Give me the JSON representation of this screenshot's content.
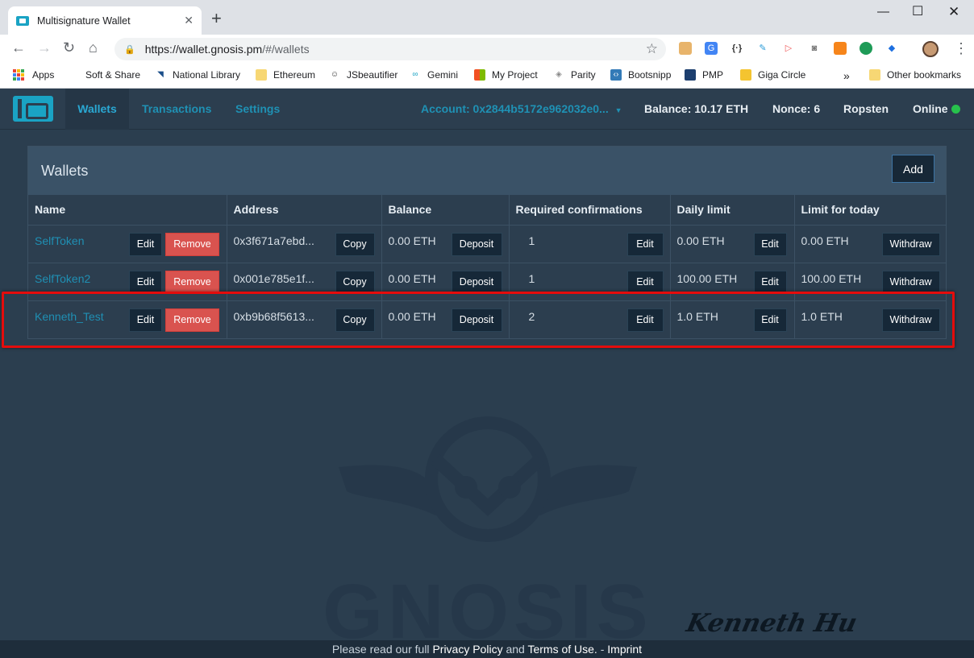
{
  "browser": {
    "tab_title": "Multisignature Wallet",
    "url_host": "https://wallet.gnosis.pm",
    "url_path": "/#/wallets",
    "bookmarks": [
      "Apps",
      "Soft & Share",
      "National Library",
      "Ethereum",
      "JSbeautifier",
      "Gemini",
      "My Project",
      "Parity",
      "Bootsnipp",
      "PMP",
      "Giga Circle",
      "Other bookmarks"
    ],
    "overflow": "»"
  },
  "nav": {
    "wallets": "Wallets",
    "transactions": "Transactions",
    "settings": "Settings",
    "account": "Account: 0x2844b5172e962032e0...",
    "balance": "Balance: 10.17 ETH",
    "nonce": "Nonce: 6",
    "network": "Ropsten",
    "status": "Online"
  },
  "panel": {
    "title": "Wallets",
    "add_label": "Add",
    "headers": [
      "Name",
      "Address",
      "Balance",
      "Required confirmations",
      "Daily limit",
      "Limit for today"
    ],
    "rows": [
      {
        "name": "SelfToken",
        "address": "0x3f671a7ebd...",
        "balance": "0.00 ETH",
        "confirmations": "1",
        "daily_limit": "0.00 ETH",
        "limit_today": "0.00 ETH"
      },
      {
        "name": "SelfToken2",
        "address": "0x001e785e1f...",
        "balance": "0.00 ETH",
        "confirmations": "1",
        "daily_limit": "100.00 ETH",
        "limit_today": "100.00 ETH"
      },
      {
        "name": "Kenneth_Test",
        "address": "0xb9b68f5613...",
        "balance": "0.00 ETH",
        "confirmations": "2",
        "daily_limit": "1.0 ETH",
        "limit_today": "1.0 ETH"
      }
    ],
    "buttons": {
      "edit": "Edit",
      "remove": "Remove",
      "copy": "Copy",
      "deposit": "Deposit",
      "withdraw": "Withdraw"
    }
  },
  "watermark": {
    "text": "GNOSIS",
    "signature": "Kenneth Hu"
  },
  "footer": {
    "prefix": "Please read our full ",
    "privacy": "Privacy Policy",
    "and": " and ",
    "terms": "Terms of Use.",
    "sep": " - ",
    "imprint": "Imprint"
  },
  "colors": {
    "accent": "#1f91b4",
    "danger": "#d9534f",
    "online": "#27c24c",
    "highlight": "#e40c0c"
  }
}
